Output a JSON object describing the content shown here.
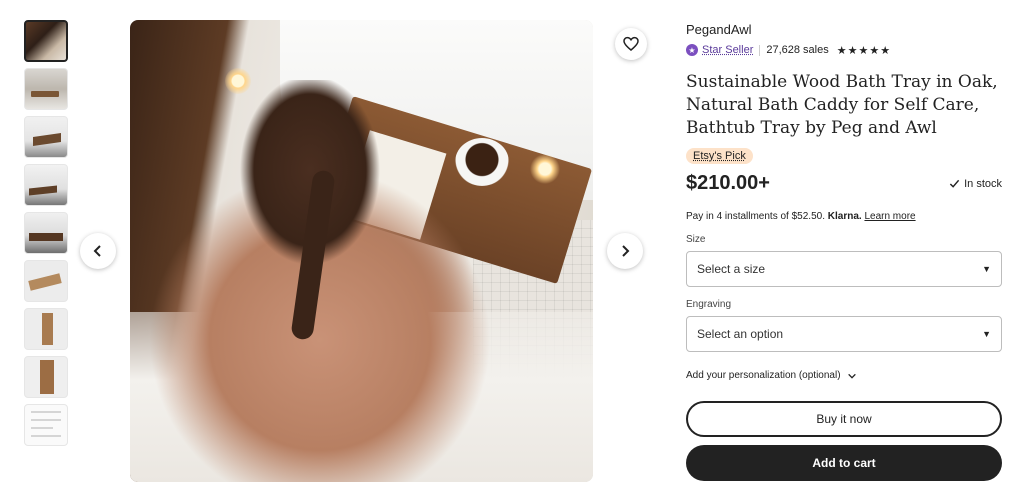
{
  "gallery": {
    "thumbnail_count": 9,
    "active_index": 0
  },
  "shop": {
    "name": "PegandAwl",
    "star_seller_label": "Star Seller",
    "sales": "27,628 sales",
    "rating_stars": "★★★★★",
    "rating_value": 5
  },
  "product": {
    "title": "Sustainable Wood Bath Tray in Oak, Natural Bath Caddy for Self Care, Bathtub Tray by Peg and Awl",
    "badge": "Etsy's Pick",
    "price": "$210.00+",
    "stock": "In stock",
    "installments_prefix": "Pay in 4 installments of $52.50.",
    "installments_provider": "Klarna.",
    "installments_link": "Learn more"
  },
  "options": {
    "size_label": "Size",
    "size_placeholder": "Select a size",
    "engraving_label": "Engraving",
    "engraving_placeholder": "Select an option",
    "personalization_label": "Add your personalization (optional)"
  },
  "actions": {
    "buy_now": "Buy it now",
    "add_to_cart": "Add to cart"
  },
  "colors": {
    "accent_dark": "#222222",
    "star_seller": "#7b4fbf",
    "pick_badge_bg": "#fde2c9"
  }
}
